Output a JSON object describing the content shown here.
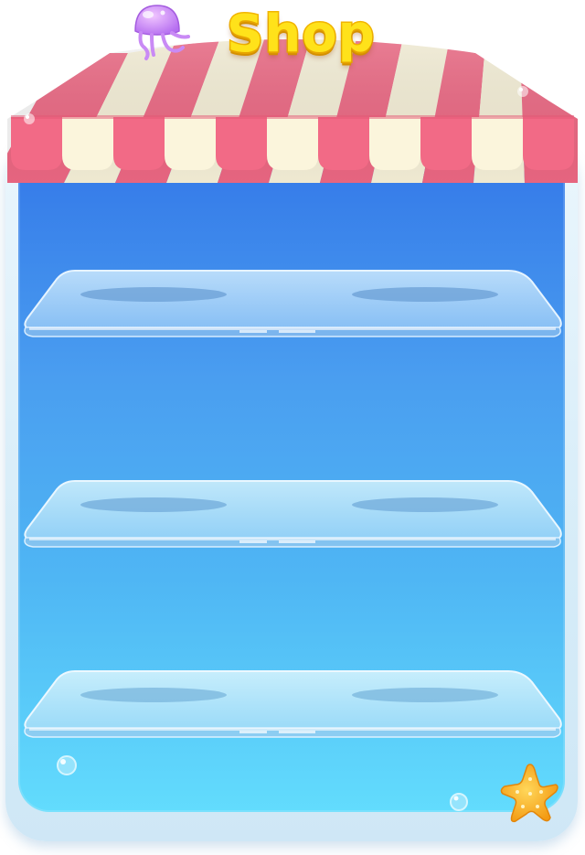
{
  "title": "Shop",
  "colors": {
    "awning_red": "#f26a86",
    "awning_cream": "#fbf5dc",
    "title_yellow": "#ffe21a",
    "cabinet_top": "#3377e8",
    "cabinet_bottom": "#62dcfd",
    "starfish": "#f8b31c",
    "jellyfish": "#c77ef5"
  },
  "icons": {
    "decoration_top": "jellyfish-icon",
    "decoration_bottom": "starfish-icon"
  },
  "shelves": [
    {
      "id": "shelf-1",
      "slots": 2
    },
    {
      "id": "shelf-2",
      "slots": 2
    },
    {
      "id": "shelf-3",
      "slots": 2
    }
  ]
}
